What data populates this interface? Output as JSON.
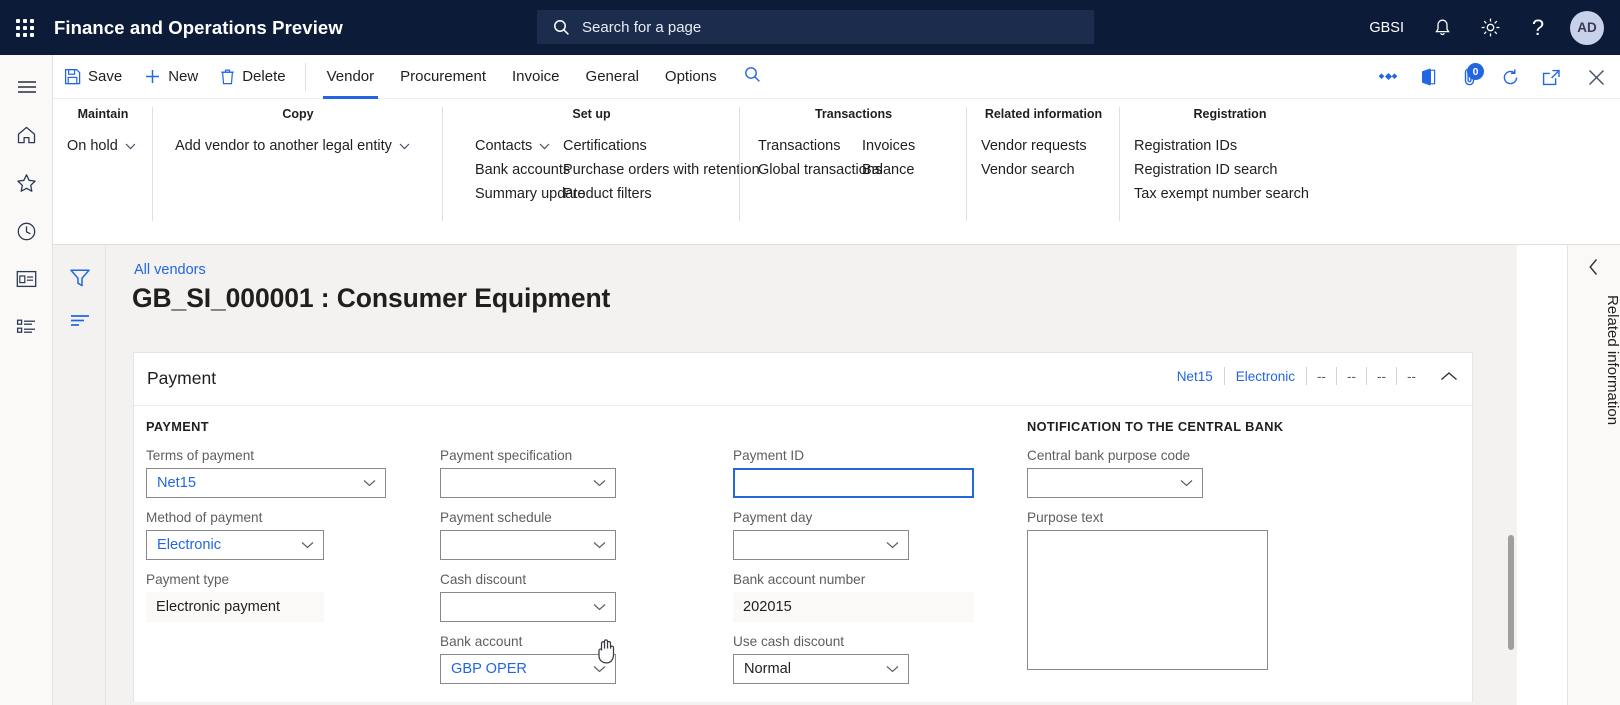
{
  "topbar": {
    "waffle_icon": "waffle-grid-icon",
    "app_title": "Finance and Operations Preview",
    "search": {
      "icon": "search-icon",
      "placeholder": "Search for a page",
      "value": ""
    },
    "company": "GBSI",
    "notifications_icon": "bell-icon",
    "settings_icon": "gear-icon",
    "help_icon": "question-mark-icon",
    "avatar_initials": "AD"
  },
  "rail": {
    "items": [
      {
        "name": "hamburger-menu",
        "icon": "hamburger-icon"
      },
      {
        "name": "home",
        "icon": "home-icon"
      },
      {
        "name": "favorites",
        "icon": "star-icon"
      },
      {
        "name": "recent",
        "icon": "clock-icon"
      },
      {
        "name": "workspaces",
        "icon": "workspace-icon"
      },
      {
        "name": "modules",
        "icon": "list-icon"
      }
    ]
  },
  "commandbar": {
    "save_label": "Save",
    "save_icon": "save-disk-icon",
    "new_label": "New",
    "new_icon": "plus-icon",
    "delete_label": "Delete",
    "delete_icon": "trash-icon",
    "tabs": [
      {
        "label": "Vendor",
        "active": true
      },
      {
        "label": "Procurement",
        "active": false
      },
      {
        "label": "Invoice",
        "active": false
      },
      {
        "label": "General",
        "active": false
      },
      {
        "label": "Options",
        "active": false
      }
    ],
    "search_icon": "search-icon",
    "right_icons": [
      {
        "name": "personalize-icon",
        "label": ""
      },
      {
        "name": "office-app-icon",
        "label": ""
      },
      {
        "name": "attachments-icon",
        "badge": "0"
      },
      {
        "name": "refresh-icon",
        "label": ""
      },
      {
        "name": "open-in-new-window-icon",
        "label": ""
      },
      {
        "name": "close-icon",
        "label": ""
      }
    ]
  },
  "ribbon": {
    "collapse_icon": "chevron-up-icon",
    "groups": [
      {
        "title": "Maintain",
        "columns": [
          [
            {
              "label": "On hold",
              "caret": true
            }
          ]
        ]
      },
      {
        "title": "Copy",
        "columns": [
          [
            {
              "label": "Add vendor to another legal entity",
              "caret": true
            }
          ]
        ]
      },
      {
        "title": "Set up",
        "columns": [
          [
            {
              "label": "Contacts",
              "caret": true
            },
            {
              "label": "Bank accounts",
              "caret": false
            },
            {
              "label": "Summary update",
              "caret": false
            }
          ],
          [
            {
              "label": "Certifications",
              "caret": false
            },
            {
              "label": "Purchase orders with retention",
              "caret": false
            },
            {
              "label": "Product filters",
              "caret": false
            }
          ]
        ]
      },
      {
        "title": "Transactions",
        "columns": [
          [
            {
              "label": "Transactions",
              "caret": false
            },
            {
              "label": "Global transactions",
              "caret": false
            }
          ],
          [
            {
              "label": "Invoices",
              "caret": false
            },
            {
              "label": "Balance",
              "caret": false
            }
          ]
        ]
      },
      {
        "title": "Related information",
        "columns": [
          [
            {
              "label": "Vendor requests",
              "caret": false
            },
            {
              "label": "Vendor search",
              "caret": false
            }
          ]
        ]
      },
      {
        "title": "Registration",
        "columns": [
          [
            {
              "label": "Registration IDs",
              "caret": false
            },
            {
              "label": "Registration ID search",
              "caret": false
            },
            {
              "label": "Tax exempt number search",
              "caret": false
            }
          ]
        ]
      }
    ]
  },
  "filterrail": {
    "filter_icon": "funnel-filter-icon",
    "list_icon": "filter-lines-icon"
  },
  "page": {
    "breadcrumb": "All vendors",
    "title": "GB_SI_000001 : Consumer Equipment"
  },
  "card": {
    "title": "Payment",
    "summary": [
      {
        "text": "Net15",
        "muted": false
      },
      {
        "text": "Electronic",
        "muted": false
      },
      {
        "text": "--",
        "muted": true
      },
      {
        "text": "--",
        "muted": true
      },
      {
        "text": "--",
        "muted": true
      },
      {
        "text": "--",
        "muted": true
      }
    ],
    "collapse_icon": "chevron-up-icon"
  },
  "form": {
    "section_payment": "PAYMENT",
    "section_central_bank": "NOTIFICATION TO THE CENTRAL BANK",
    "col1": [
      {
        "label": "Terms of payment",
        "value": "Net15",
        "type": "combo",
        "link": true
      },
      {
        "label": "Method of payment",
        "value": "Electronic",
        "type": "combo-narrow",
        "link": true
      },
      {
        "label": "Payment type",
        "value": "Electronic payment",
        "type": "readonly",
        "link": false
      }
    ],
    "col2": [
      {
        "label": "Payment specification",
        "value": "",
        "type": "combo",
        "link": false
      },
      {
        "label": "Payment schedule",
        "value": "",
        "type": "combo",
        "link": false
      },
      {
        "label": "Cash discount",
        "value": "",
        "type": "combo",
        "link": false
      },
      {
        "label": "Bank account",
        "value": "GBP OPER",
        "type": "combo",
        "link": true
      }
    ],
    "col3": [
      {
        "label": "Payment ID",
        "value": "",
        "type": "text-focused",
        "link": false
      },
      {
        "label": "Payment day",
        "value": "",
        "type": "combo",
        "link": false
      },
      {
        "label": "Bank account number",
        "value": "202015",
        "type": "readonly",
        "link": false
      },
      {
        "label": "Use cash discount",
        "value": "Normal",
        "type": "combo",
        "link": false
      }
    ],
    "col4": [
      {
        "label": "Central bank purpose code",
        "value": "",
        "type": "combo",
        "link": false
      },
      {
        "label": "Purpose text",
        "value": "",
        "type": "textarea",
        "link": false
      }
    ]
  },
  "rightpane": {
    "collapse_icon": "chevron-left-icon",
    "label": "Related information"
  },
  "colors": {
    "brand_navy": "#0b1b38",
    "accent_blue": "#2266e3",
    "surface": "#f3f2f1",
    "card": "#ffffff",
    "border": "#8a8886"
  }
}
